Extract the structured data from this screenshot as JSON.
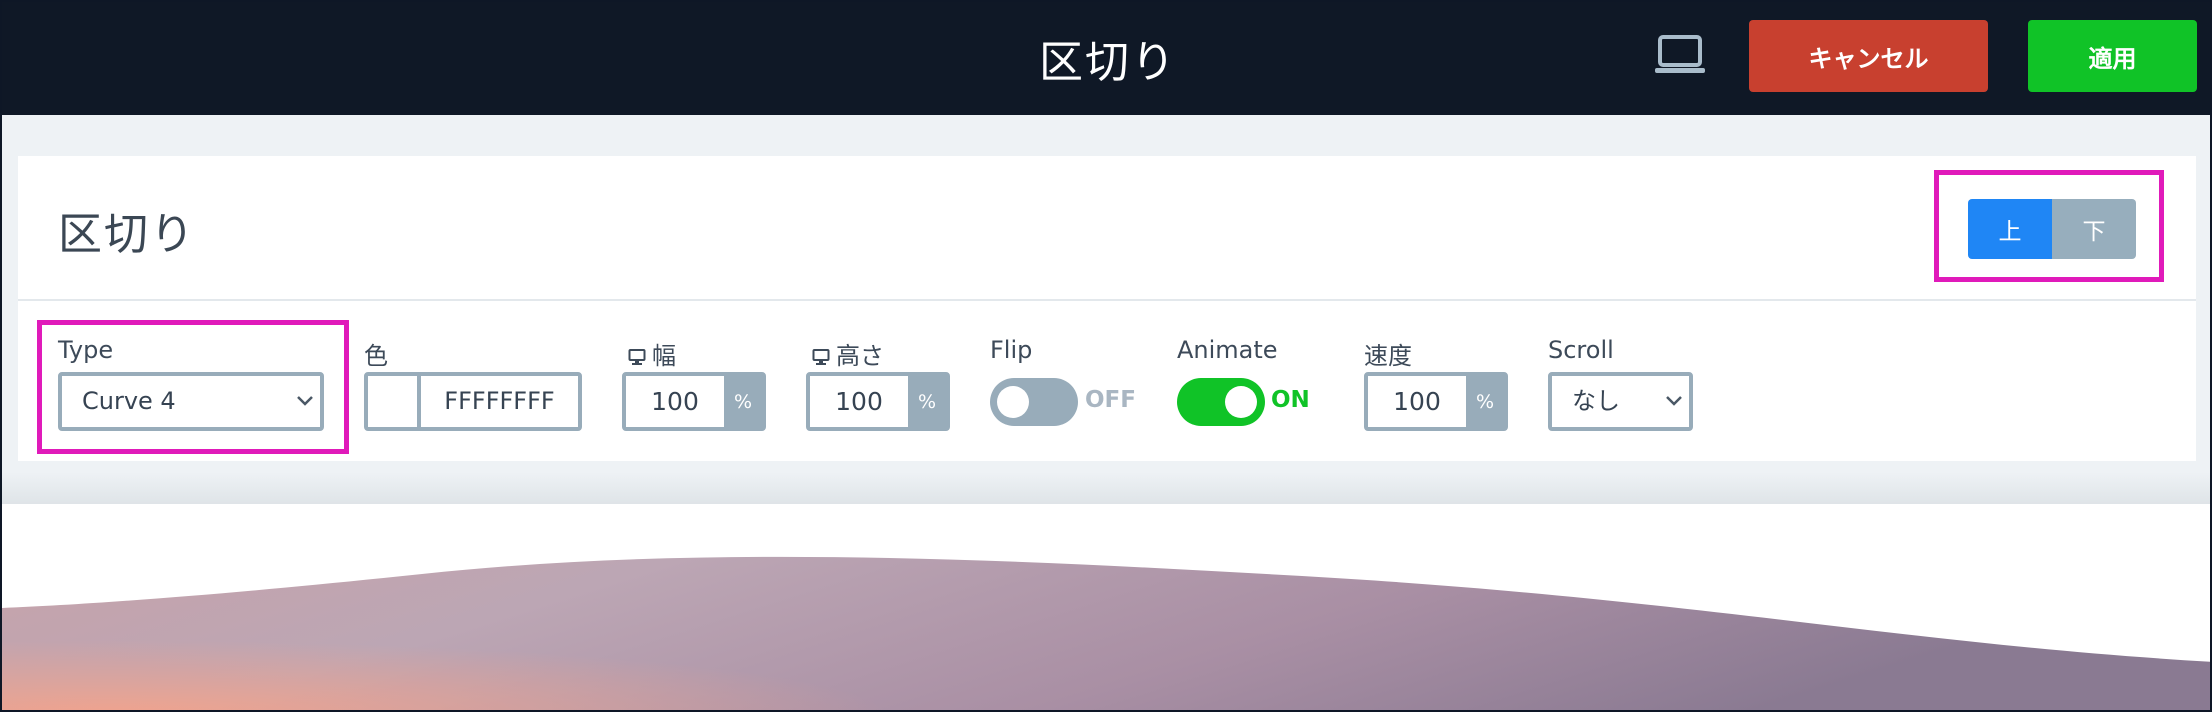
{
  "header": {
    "title": "区切り",
    "device_icon": "laptop-icon",
    "cancel_label": "キャンセル",
    "apply_label": "適用",
    "colors": {
      "bar": "#0f1826",
      "cancel": "#c8402f",
      "apply": "#10c327"
    }
  },
  "panel": {
    "title": "区切り",
    "position_toggle": {
      "options": [
        "上",
        "下"
      ],
      "selected": "上"
    }
  },
  "controls": {
    "type": {
      "label": "Type",
      "value": "Curve 4"
    },
    "color": {
      "label": "色",
      "value": "FFFFFFFF",
      "swatch": "#ffffff"
    },
    "width": {
      "label": "幅",
      "icon": "desktop-icon",
      "value": "100",
      "unit": "%"
    },
    "height": {
      "label": "高さ",
      "icon": "desktop-icon",
      "value": "100",
      "unit": "%"
    },
    "flip": {
      "label": "Flip",
      "state": "OFF",
      "on": false
    },
    "animate": {
      "label": "Animate",
      "state": "ON",
      "on": true
    },
    "speed": {
      "label": "速度",
      "value": "100",
      "unit": "%"
    },
    "scroll": {
      "label": "Scroll",
      "value": "なし"
    }
  },
  "annotation_color": "#e01aba"
}
